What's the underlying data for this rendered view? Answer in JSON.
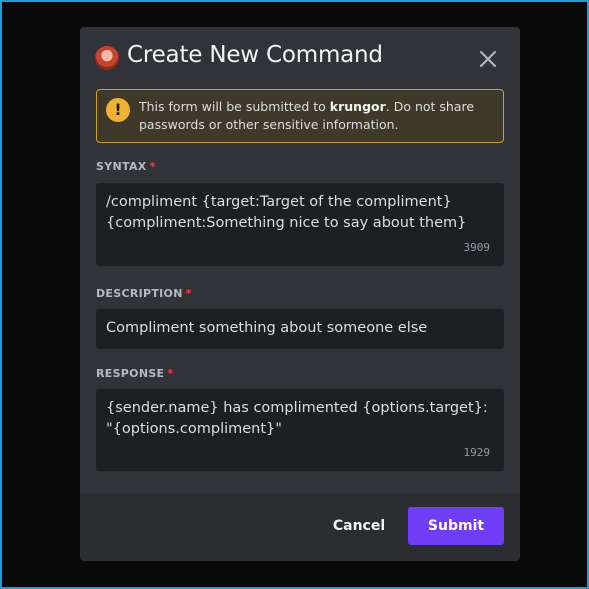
{
  "modal": {
    "title": "Create New Command",
    "close_icon": "close-icon",
    "avatar_icon": "bot-avatar"
  },
  "warning": {
    "icon": "exclamation-icon",
    "prefix": "This form will be submitted to ",
    "bot_name": "krungor",
    "suffix": ". Do not share passwords or other sensitive information."
  },
  "syntax": {
    "label": "SYNTAX",
    "required_marker": "*",
    "value": "/compliment {target:Target of the compliment} {compliment:Something nice to say about them}",
    "counter": "3909"
  },
  "description": {
    "label": "DESCRIPTION",
    "required_marker": "*",
    "value": "Compliment something about someone else"
  },
  "response": {
    "label": "RESPONSE",
    "required_marker": "*",
    "value": "{sender.name} has complimented {options.target}: \"{options.compliment}\"",
    "counter": "1929"
  },
  "footer": {
    "cancel_label": "Cancel",
    "submit_label": "Submit"
  },
  "colors": {
    "accent": "#6e3df5",
    "warning_border": "#c9a423",
    "required": "#f23f42"
  }
}
